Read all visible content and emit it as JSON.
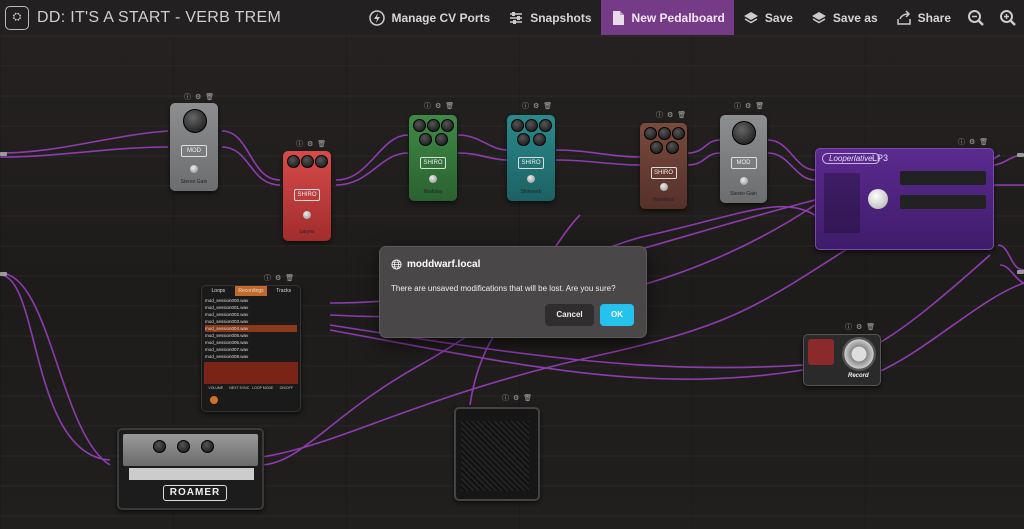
{
  "topbar": {
    "title": "DD: IT'S A START - VERB TREM",
    "manage_cv_ports": "Manage CV Ports",
    "snapshots": "Snapshots",
    "new_pedalboard": "New Pedalboard",
    "save": "Save",
    "save_as": "Save as",
    "share": "Share"
  },
  "pedals": {
    "stereo_gain_1": {
      "badge": "MOD",
      "label": "Stereo Gain"
    },
    "shiro_larynx": {
      "badge": "SHIRO",
      "label": "Larynx"
    },
    "shiro_modulay": {
      "badge": "SHIRO",
      "label": "Modulay"
    },
    "shiro_shimmerlo": {
      "badge": "SHIRO",
      "label": "Shimverb"
    },
    "shiro_harmless": {
      "badge": "SHIRO",
      "label": "Harmless"
    },
    "stereo_gain_2": {
      "badge": "MOD",
      "label": "Stereo Gain"
    },
    "looperlative": {
      "brand": "Looperlative",
      "model": "LP3"
    },
    "roamer": {
      "name": "ROAMER"
    },
    "record": {
      "name": "Record"
    }
  },
  "recorder": {
    "tabs": [
      "Loops",
      "Recordings",
      "Tracks"
    ],
    "files": [
      "mod_session000.wav",
      "mod_session001.wav",
      "mod_session002.wav",
      "mod_session003.wav",
      "mod_session004.wav",
      "mod_session005.wav",
      "mod_session006.wav",
      "mod_session007.wav",
      "mod_session008.wav"
    ],
    "selected_index": 4,
    "controls": [
      "VOLUME",
      "NEXT SYNC",
      "LOOP MODE",
      "ON/OFF"
    ]
  },
  "dialog": {
    "host": "moddwarf.local",
    "message": "There are unsaved modifications that will be lost. Are you sure?",
    "cancel": "Cancel",
    "ok": "OK"
  },
  "colors": {
    "accent_purple": "#763b86",
    "ok_button": "#26c2ee",
    "cable": "#9b3fc0"
  }
}
